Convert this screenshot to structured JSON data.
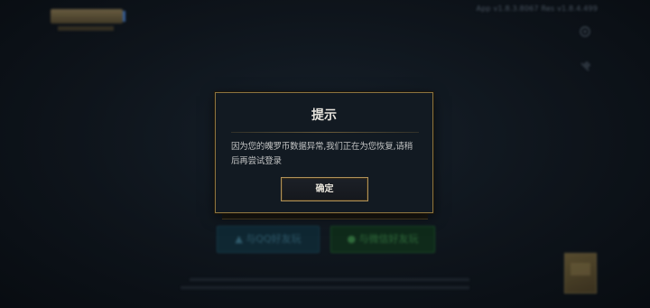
{
  "background": {
    "version_text": "App v1.8.3.8067 Res v1.8.4.499",
    "qq_login_label": "与QQ好友玩",
    "wechat_login_label": "与微信好友玩"
  },
  "dialog": {
    "title": "提示",
    "message": "因为您的魄罗币数据异常,我们正在为您恢复,请稍后再尝试登录",
    "confirm_label": "确定"
  },
  "colors": {
    "dialog_border": "#8c7440",
    "button_border": "#b0925a",
    "background": "#0c1117"
  }
}
